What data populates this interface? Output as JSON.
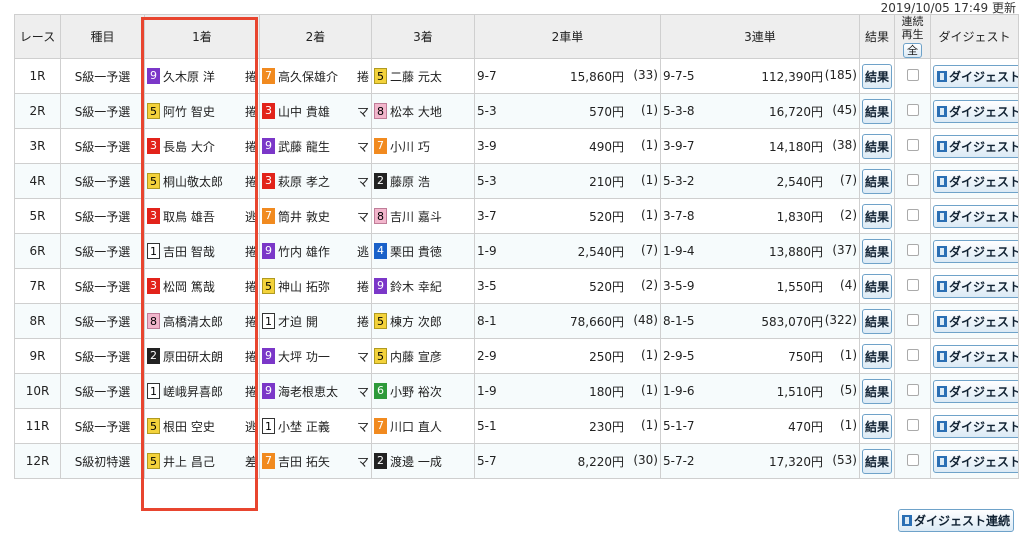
{
  "updated": "2019/10/05 17:49 更新",
  "headers": {
    "race": "レース",
    "class": "種目",
    "first": "1着",
    "second": "2着",
    "third": "3着",
    "exacta": "2車単",
    "trifecta": "3連単",
    "result": "結果",
    "continuous_line1": "連続",
    "continuous_line2": "再生",
    "select_all": "全",
    "digest": "ダイジェスト"
  },
  "buttons": {
    "result_label": "結果",
    "digest_label": "ダイジェスト",
    "digest_continuous": "ダイジェスト連続"
  },
  "colors": {
    "highlight": "#e8452f",
    "header_bg": "#eeeeee"
  },
  "rows": [
    {
      "race": "1R",
      "class": "S級一予選",
      "first": {
        "num": "9",
        "name": "久木原 洋",
        "tactic": "捲"
      },
      "second": {
        "num": "7",
        "name": "高久保雄介",
        "tactic": "捲"
      },
      "third": {
        "num": "5",
        "name": "二藤 元太"
      },
      "exacta": {
        "combo": "9-7",
        "payout": "15,860円",
        "pop": "(33)"
      },
      "trifecta": {
        "combo": "9-7-5",
        "payout": "112,390円",
        "pop": "(185)"
      }
    },
    {
      "race": "2R",
      "class": "S級一予選",
      "first": {
        "num": "5",
        "name": "阿竹 智史",
        "tactic": "捲"
      },
      "second": {
        "num": "3",
        "name": "山中 貴雄",
        "tactic": "マ"
      },
      "third": {
        "num": "8",
        "name": "松本 大地"
      },
      "exacta": {
        "combo": "5-3",
        "payout": "570円",
        "pop": "(1)"
      },
      "trifecta": {
        "combo": "5-3-8",
        "payout": "16,720円",
        "pop": "(45)"
      }
    },
    {
      "race": "3R",
      "class": "S級一予選",
      "first": {
        "num": "3",
        "name": "長島 大介",
        "tactic": "捲"
      },
      "second": {
        "num": "9",
        "name": "武藤 龍生",
        "tactic": "マ"
      },
      "third": {
        "num": "7",
        "name": "小川 巧"
      },
      "exacta": {
        "combo": "3-9",
        "payout": "490円",
        "pop": "(1)"
      },
      "trifecta": {
        "combo": "3-9-7",
        "payout": "14,180円",
        "pop": "(38)"
      }
    },
    {
      "race": "4R",
      "class": "S級一予選",
      "first": {
        "num": "5",
        "name": "桐山敬太郎",
        "tactic": "捲"
      },
      "second": {
        "num": "3",
        "name": "萩原 孝之",
        "tactic": "マ"
      },
      "third": {
        "num": "2",
        "name": "藤原 浩"
      },
      "exacta": {
        "combo": "5-3",
        "payout": "210円",
        "pop": "(1)"
      },
      "trifecta": {
        "combo": "5-3-2",
        "payout": "2,540円",
        "pop": "(7)"
      }
    },
    {
      "race": "5R",
      "class": "S級一予選",
      "first": {
        "num": "3",
        "name": "取鳥 雄吾",
        "tactic": "逃"
      },
      "second": {
        "num": "7",
        "name": "筒井 敦史",
        "tactic": "マ"
      },
      "third": {
        "num": "8",
        "name": "吉川 嘉斗"
      },
      "exacta": {
        "combo": "3-7",
        "payout": "520円",
        "pop": "(1)"
      },
      "trifecta": {
        "combo": "3-7-8",
        "payout": "1,830円",
        "pop": "(2)"
      }
    },
    {
      "race": "6R",
      "class": "S級一予選",
      "first": {
        "num": "1",
        "name": "吉田 智哉",
        "tactic": "捲"
      },
      "second": {
        "num": "9",
        "name": "竹内 雄作",
        "tactic": "逃"
      },
      "third": {
        "num": "4",
        "name": "栗田 貴徳"
      },
      "exacta": {
        "combo": "1-9",
        "payout": "2,540円",
        "pop": "(7)"
      },
      "trifecta": {
        "combo": "1-9-4",
        "payout": "13,880円",
        "pop": "(37)"
      }
    },
    {
      "race": "7R",
      "class": "S級一予選",
      "first": {
        "num": "3",
        "name": "松岡 篤哉",
        "tactic": "捲"
      },
      "second": {
        "num": "5",
        "name": "神山 拓弥",
        "tactic": "捲"
      },
      "third": {
        "num": "9",
        "name": "鈴木 幸紀"
      },
      "exacta": {
        "combo": "3-5",
        "payout": "520円",
        "pop": "(2)"
      },
      "trifecta": {
        "combo": "3-5-9",
        "payout": "1,550円",
        "pop": "(4)"
      }
    },
    {
      "race": "8R",
      "class": "S級一予選",
      "first": {
        "num": "8",
        "name": "高橋清太郎",
        "tactic": "捲"
      },
      "second": {
        "num": "1",
        "name": "才迫 開",
        "tactic": "捲"
      },
      "third": {
        "num": "5",
        "name": "棟方 次郎"
      },
      "exacta": {
        "combo": "8-1",
        "payout": "78,660円",
        "pop": "(48)"
      },
      "trifecta": {
        "combo": "8-1-5",
        "payout": "583,070円",
        "pop": "(322)"
      }
    },
    {
      "race": "9R",
      "class": "S級一予選",
      "first": {
        "num": "2",
        "name": "原田研太朗",
        "tactic": "捲"
      },
      "second": {
        "num": "9",
        "name": "大坪 功一",
        "tactic": "マ"
      },
      "third": {
        "num": "5",
        "name": "内藤 宣彦"
      },
      "exacta": {
        "combo": "2-9",
        "payout": "250円",
        "pop": "(1)"
      },
      "trifecta": {
        "combo": "2-9-5",
        "payout": "750円",
        "pop": "(1)"
      }
    },
    {
      "race": "10R",
      "class": "S級一予選",
      "first": {
        "num": "1",
        "name": "嵯峨昇喜郎",
        "tactic": "捲"
      },
      "second": {
        "num": "9",
        "name": "海老根恵太",
        "tactic": "マ"
      },
      "third": {
        "num": "6",
        "name": "小野 裕次"
      },
      "exacta": {
        "combo": "1-9",
        "payout": "180円",
        "pop": "(1)"
      },
      "trifecta": {
        "combo": "1-9-6",
        "payout": "1,510円",
        "pop": "(5)"
      }
    },
    {
      "race": "11R",
      "class": "S級一予選",
      "first": {
        "num": "5",
        "name": "根田 空史",
        "tactic": "逃"
      },
      "second": {
        "num": "1",
        "name": "小埜 正義",
        "tactic": "マ"
      },
      "third": {
        "num": "7",
        "name": "川口 直人"
      },
      "exacta": {
        "combo": "5-1",
        "payout": "230円",
        "pop": "(1)"
      },
      "trifecta": {
        "combo": "5-1-7",
        "payout": "470円",
        "pop": "(1)"
      }
    },
    {
      "race": "12R",
      "class": "S級初特選",
      "first": {
        "num": "5",
        "name": "井上 昌己",
        "tactic": "差"
      },
      "second": {
        "num": "7",
        "name": "吉田 拓矢",
        "tactic": "マ"
      },
      "third": {
        "num": "2",
        "name": "渡邊 一成"
      },
      "exacta": {
        "combo": "5-7",
        "payout": "8,220円",
        "pop": "(30)"
      },
      "trifecta": {
        "combo": "5-7-2",
        "payout": "17,320円",
        "pop": "(53)"
      }
    }
  ]
}
